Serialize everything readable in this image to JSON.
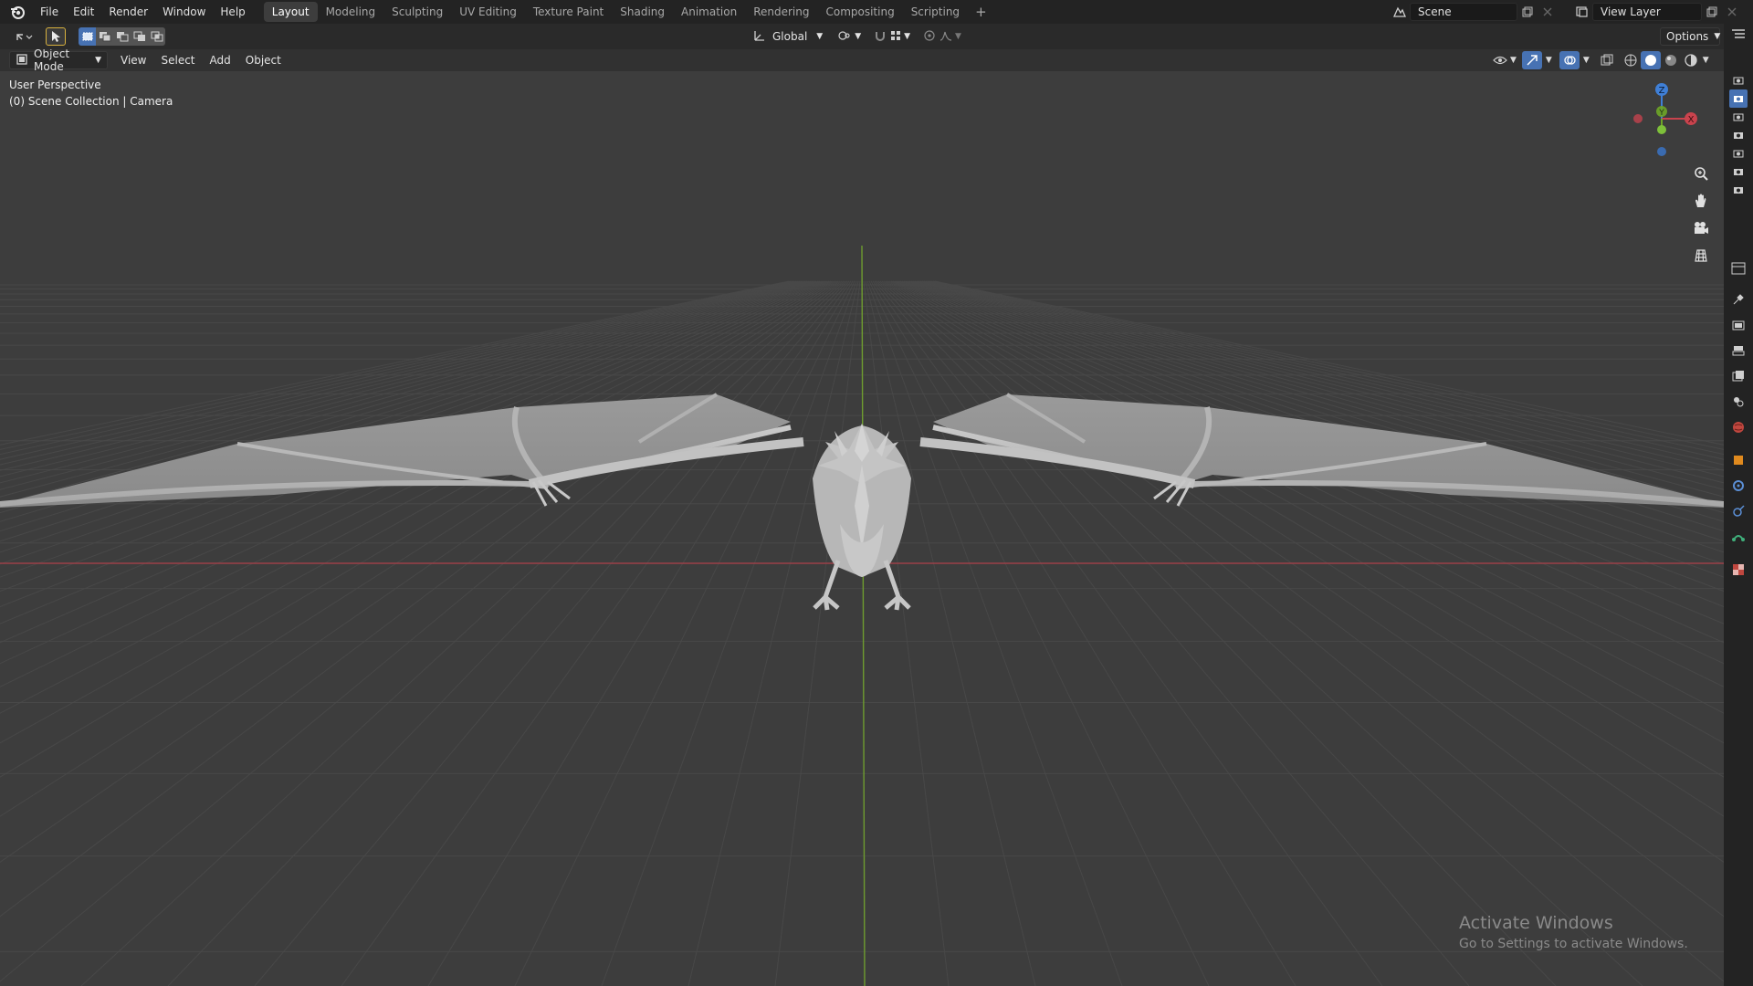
{
  "topbar": {
    "menus": [
      "File",
      "Edit",
      "Render",
      "Window",
      "Help"
    ],
    "workspaces": [
      "Layout",
      "Modeling",
      "Sculpting",
      "UV Editing",
      "Texture Paint",
      "Shading",
      "Animation",
      "Rendering",
      "Compositing",
      "Scripting"
    ],
    "active_workspace": "Layout",
    "add_tab": "+",
    "scene_name": "Scene",
    "view_layer_name": "View Layer"
  },
  "toolheader": {
    "transform_orientation": "Global",
    "options_label": "Options"
  },
  "viewport_header": {
    "mode": "Object Mode",
    "menus": [
      "View",
      "Select",
      "Add",
      "Object"
    ]
  },
  "viewport": {
    "perspective_label": "User Perspective",
    "collection_label": "(0) Scene Collection | Camera",
    "gizmo_axes": {
      "z": "Z",
      "x": "X",
      "y": "Y"
    }
  },
  "colors": {
    "x_axis": "#c9434d",
    "y_axis": "#6ea627",
    "z_axis": "#3f7fd6",
    "accent": "#4772b3"
  },
  "watermark": {
    "title": "Activate Windows",
    "subtitle": "Go to Settings to activate Windows."
  },
  "icons": {
    "editor_type": "editor-type-icon",
    "select_tool": "cursor-select-icon",
    "zoom": "zoom-icon",
    "pan": "hand-icon",
    "camera": "camera-view-icon",
    "ortho": "grid-ortho-icon"
  }
}
